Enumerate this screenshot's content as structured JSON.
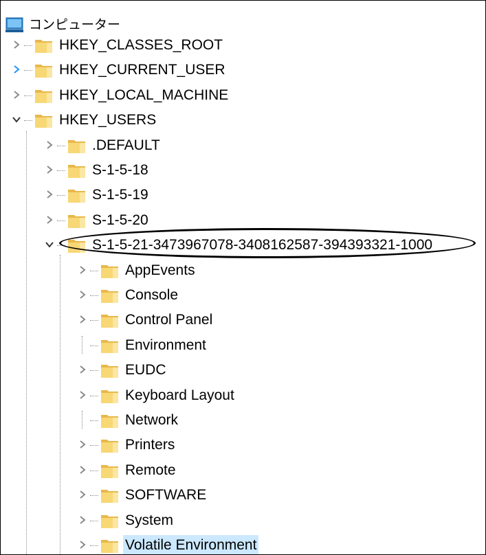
{
  "tree": {
    "root": {
      "label": "コンピューター",
      "icon": "computer-icon"
    },
    "hives": [
      {
        "label": "HKEY_CLASSES_ROOT",
        "expanded": false
      },
      {
        "label": "HKEY_CURRENT_USER",
        "expanded": false,
        "hover": true
      },
      {
        "label": "HKEY_LOCAL_MACHINE",
        "expanded": false
      },
      {
        "label": "HKEY_USERS",
        "expanded": true
      }
    ],
    "users": [
      {
        "label": ".DEFAULT",
        "expanded": false
      },
      {
        "label": "S-1-5-18",
        "expanded": false
      },
      {
        "label": "S-1-5-19",
        "expanded": false
      },
      {
        "label": "S-1-5-20",
        "expanded": false
      },
      {
        "label": "S-1-5-21-3473967078-3408162587-394393321-1000",
        "expanded": true,
        "circled": true
      }
    ],
    "subkeys": [
      {
        "label": "AppEvents",
        "has_children": true
      },
      {
        "label": "Console",
        "has_children": true
      },
      {
        "label": "Control Panel",
        "has_children": true
      },
      {
        "label": "Environment",
        "has_children": false
      },
      {
        "label": "EUDC",
        "has_children": true
      },
      {
        "label": "Keyboard Layout",
        "has_children": true
      },
      {
        "label": "Network",
        "has_children": false
      },
      {
        "label": "Printers",
        "has_children": true
      },
      {
        "label": "Remote",
        "has_children": true
      },
      {
        "label": "SOFTWARE",
        "has_children": true
      },
      {
        "label": "System",
        "has_children": true
      },
      {
        "label": "Volatile Environment",
        "has_children": true,
        "selected": true
      }
    ]
  },
  "colors": {
    "folder": "#f8d775",
    "folder_dark": "#e8b84a",
    "chevron": "#8a8a8a",
    "chevron_hover": "#1e90ff",
    "selection": "#cce8ff"
  }
}
